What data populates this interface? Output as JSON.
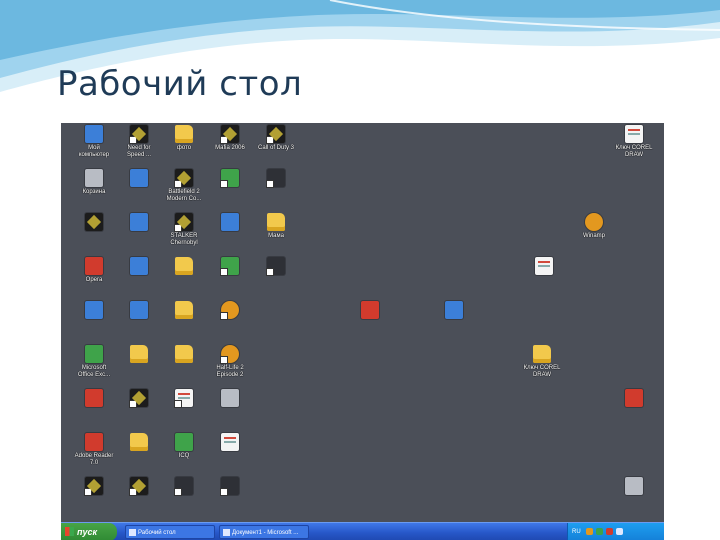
{
  "slide": {
    "title": "Рабочий стол"
  },
  "colors": {
    "desktop_bg": "#4b4f58",
    "taskbar": "#2757c8",
    "start_green": "#3f9a3e",
    "title_text": "#1f3b57",
    "swoosh": "#7ec3e6"
  },
  "desktop": {
    "icons": [
      {
        "label": "Мой\nкомпьютер",
        "icon": "computer-icon",
        "kind": "app"
      },
      {
        "label": "Need for\nSpeed ...",
        "icon": "game-icon",
        "kind": "game"
      },
      {
        "label": "фото",
        "icon": "folder-icon",
        "kind": "folder"
      },
      {
        "label": "Mafia 2006",
        "icon": "game-icon",
        "kind": "game"
      },
      {
        "label": "Call of Duty 3",
        "icon": "game-icon",
        "kind": "game"
      },
      {
        "label": "Ключ COREL\nDRAW",
        "icon": "document-icon",
        "kind": "doc"
      },
      {
        "label": "Корзина",
        "icon": "recycle-bin-icon",
        "kind": "gray"
      },
      {
        "label": "",
        "icon": "media-player-icon",
        "kind": "app"
      },
      {
        "label": "Battlefield 2\nModern Co...",
        "icon": "game-icon",
        "kind": "game"
      },
      {
        "label": "",
        "icon": "game-icon",
        "kind": "green"
      },
      {
        "label": "",
        "icon": "game-icon",
        "kind": "dark"
      },
      {
        "label": "",
        "icon": "game-icon",
        "kind": "game"
      },
      {
        "label": "",
        "icon": "internet-explorer-icon",
        "kind": "app"
      },
      {
        "label": "STALKER\nChernobyl",
        "icon": "game-icon",
        "kind": "game"
      },
      {
        "label": "",
        "icon": "app-icon",
        "kind": "app"
      },
      {
        "label": "Мама",
        "icon": "folder-icon",
        "kind": "folder"
      },
      {
        "label": "Winamp",
        "icon": "winamp-icon",
        "kind": "orange"
      },
      {
        "label": "Opera",
        "icon": "opera-icon",
        "kind": "red"
      },
      {
        "label": "",
        "icon": "app-icon",
        "kind": "app"
      },
      {
        "label": "",
        "icon": "folder-icon",
        "kind": "folder"
      },
      {
        "label": "",
        "icon": "game-icon",
        "kind": "green"
      },
      {
        "label": "",
        "icon": "app-icon",
        "kind": "dark"
      },
      {
        "label": "",
        "icon": "document-icon",
        "kind": "doc"
      },
      {
        "label": "",
        "icon": "word-icon",
        "kind": "app"
      },
      {
        "label": "",
        "icon": "app-icon",
        "kind": "app"
      },
      {
        "label": "",
        "icon": "folder-icon",
        "kind": "folder"
      },
      {
        "label": "",
        "icon": "game-icon",
        "kind": "orange"
      },
      {
        "label": "",
        "icon": "powerpoint-icon",
        "kind": "red"
      },
      {
        "label": "",
        "icon": "document-icon",
        "kind": "app"
      },
      {
        "label": "Microsoft\nOffice Exc...",
        "icon": "excel-icon",
        "kind": "green"
      },
      {
        "label": "",
        "icon": "folder-icon",
        "kind": "folder"
      },
      {
        "label": "",
        "icon": "folder-icon",
        "kind": "folder"
      },
      {
        "label": "Half-Life 2\nEpisode 2",
        "icon": "game-icon",
        "kind": "orange"
      },
      {
        "label": "Ключ COREL\nDRAW",
        "icon": "folder-icon",
        "kind": "folder"
      },
      {
        "label": "",
        "icon": "app-icon",
        "kind": "red"
      },
      {
        "label": "",
        "icon": "game-icon",
        "kind": "game"
      },
      {
        "label": "",
        "icon": "document-icon",
        "kind": "doc"
      },
      {
        "label": "",
        "icon": "document-icon",
        "kind": "gray"
      },
      {
        "label": "",
        "icon": "powerpoint-icon",
        "kind": "red"
      },
      {
        "label": "Adobe Reader\n7.0",
        "icon": "adobe-reader-icon",
        "kind": "red"
      },
      {
        "label": "",
        "icon": "folder-icon",
        "kind": "folder"
      },
      {
        "label": "ICQ",
        "icon": "icq-icon",
        "kind": "green"
      },
      {
        "label": "",
        "icon": "document-icon",
        "kind": "doc"
      },
      {
        "label": "",
        "icon": "game-icon",
        "kind": "game"
      },
      {
        "label": "",
        "icon": "game-icon",
        "kind": "game"
      },
      {
        "label": "",
        "icon": "app-icon",
        "kind": "dark"
      },
      {
        "label": "",
        "icon": "game-icon",
        "kind": "dark"
      },
      {
        "label": "",
        "icon": "recycle-bin-icon",
        "kind": "gray"
      }
    ]
  },
  "taskbar": {
    "start_label": "пуск",
    "tasks": [
      {
        "label": "Рабочий стол"
      },
      {
        "label": "Документ1 - Microsoft ..."
      }
    ],
    "tray": {
      "language": "RU",
      "clock": ""
    }
  }
}
